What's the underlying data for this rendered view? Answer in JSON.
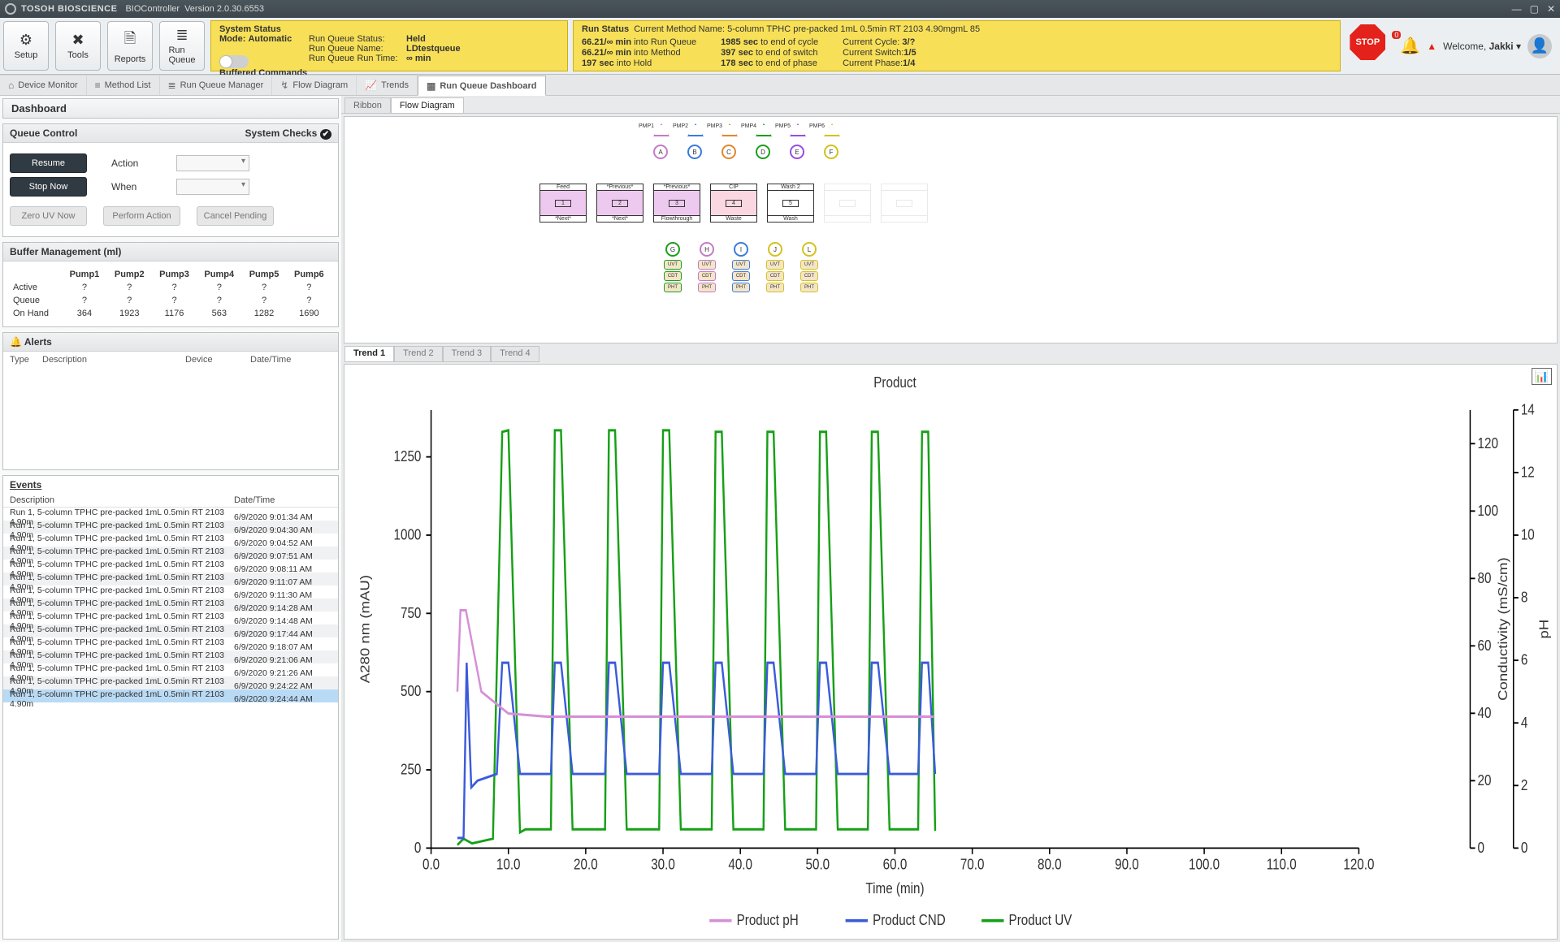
{
  "title_bar": {
    "brand": "TOSOH BIOSCIENCE",
    "app": "BIOController",
    "version": "Version 2.0.30.6553"
  },
  "ribbon_buttons": [
    {
      "label": "Setup",
      "icon": "⚙"
    },
    {
      "label": "Tools",
      "icon": "✖"
    },
    {
      "label": "Reports",
      "icon": "🗎"
    },
    {
      "label": "Run\nQueue",
      "icon": "≣"
    }
  ],
  "system_status": {
    "heading": "System Status",
    "mode_label": "Mode:",
    "mode_value": "Automatic",
    "rqs_label": "Run Queue Status:",
    "rqs_value": "Held",
    "rqn_label": "Run Queue Name:",
    "rqn_value": "LDtestqueue",
    "rqrt_label": "Run Queue Run Time:",
    "rqrt_value": "∞ min",
    "buffered_cmds": "Buffered Commands"
  },
  "run_status": {
    "heading": "Run Status",
    "cm_label": "Current Method Name:",
    "cm_value": "5-column TPHC pre-packed 1mL 0.5min RT 2103 4.90mgmL 85",
    "l1a": "66.21/∞ min",
    "l1b": "into Run Queue",
    "l2a": "66.21/∞ min",
    "l2b": "into Method",
    "l3a": "197 sec",
    "l3b": "into Hold",
    "r1a": "1985 sec",
    "r1b": "to end of cycle",
    "r2a": "397 sec",
    "r2b": "to end of switch",
    "r3a": "178 sec",
    "r3b": "to end of phase",
    "cc_label": "Current Cycle:",
    "cc_val": "3/?",
    "cs_label": "Current Switch:",
    "cs_val": "1/5",
    "cp_label": "Current Phase:",
    "cp_val": "1/4"
  },
  "stop_label": "STOP",
  "notif_count": "0",
  "welcome": "Welcome, ",
  "username": "Jakki",
  "nav_tabs": [
    {
      "label": "Device Monitor",
      "icon": "⌂"
    },
    {
      "label": "Method List",
      "icon": "≡"
    },
    {
      "label": "Run Queue Manager",
      "icon": "≣"
    },
    {
      "label": "Flow Diagram",
      "icon": "↯"
    },
    {
      "label": "Trends",
      "icon": "📈"
    },
    {
      "label": "Run Queue Dashboard",
      "icon": "▦",
      "active": true
    }
  ],
  "dashboard_label": "Dashboard",
  "queue_control": {
    "title": "Queue Control",
    "system_checks": "System Checks",
    "resume": "Resume",
    "stop_now": "Stop Now",
    "action": "Action",
    "when": "When",
    "zero_uv": "Zero UV Now",
    "perform": "Perform Action",
    "cancel": "Cancel Pending"
  },
  "buffer": {
    "title": "Buffer Management (ml)",
    "pumps": [
      "Pump1",
      "Pump2",
      "Pump3",
      "Pump4",
      "Pump5",
      "Pump6"
    ],
    "rows": [
      {
        "label": "Active",
        "vals": [
          "?",
          "?",
          "?",
          "?",
          "?",
          "?"
        ]
      },
      {
        "label": "Queue",
        "vals": [
          "?",
          "?",
          "?",
          "?",
          "?",
          "?"
        ]
      },
      {
        "label": "On Hand",
        "vals": [
          "364",
          "1923",
          "1176",
          "563",
          "1282",
          "1690"
        ]
      }
    ]
  },
  "alerts": {
    "title": "Alerts",
    "cols": [
      "Type",
      "Description",
      "Device",
      "Date/Time"
    ]
  },
  "events": {
    "title": "Events",
    "cols": [
      "Description",
      "Date/Time"
    ],
    "desc_base": "Run 1, 5-column TPHC pre-packed 1mL 0.5min RT 2103 4.90m",
    "times": [
      "6/9/2020 9:01:34 AM",
      "6/9/2020 9:04:30 AM",
      "6/9/2020 9:04:52 AM",
      "6/9/2020 9:07:51 AM",
      "6/9/2020 9:08:11 AM",
      "6/9/2020 9:11:07 AM",
      "6/9/2020 9:11:30 AM",
      "6/9/2020 9:14:28 AM",
      "6/9/2020 9:14:48 AM",
      "6/9/2020 9:17:44 AM",
      "6/9/2020 9:18:07 AM",
      "6/9/2020 9:21:06 AM",
      "6/9/2020 9:21:26 AM",
      "6/9/2020 9:24:22 AM",
      "6/9/2020 9:24:44 AM"
    ]
  },
  "right_tabs": [
    "Ribbon",
    "Flow Diagram"
  ],
  "right_active": 1,
  "trend_tabs": [
    "Trend 1",
    "Trend 2",
    "Trend 3",
    "Trend 4"
  ],
  "trend_active": 0,
  "flow_diagram": {
    "pumps": [
      "PMP1",
      "PMP2",
      "PMP3",
      "PMP4",
      "PMP5",
      "PMP6"
    ],
    "inlets": [
      "A",
      "B",
      "C",
      "D",
      "E",
      "F"
    ],
    "columns": [
      {
        "top": "Feed",
        "num": "1",
        "bot": "*Next*",
        "color": "#c47bc8"
      },
      {
        "top": "*Previous*",
        "num": "2",
        "bot": "*Next*",
        "color": "#c47bc8"
      },
      {
        "top": "*Previous*",
        "num": "3",
        "bot": "Flowthrough",
        "color": "#c47bc8"
      },
      {
        "top": "CIP",
        "num": "4",
        "bot": "Waste",
        "color": "#f1a1b5"
      },
      {
        "top": "Wash 2",
        "num": "5",
        "bot": "Wash",
        "color": "#b7b9ba"
      }
    ],
    "outlets": [
      "G",
      "H",
      "I",
      "J",
      "L"
    ],
    "sensor_stack": [
      "UVT",
      "CDT",
      "PHT"
    ]
  },
  "chart_data": {
    "type": "line",
    "title": "Product",
    "xlabel": "Time (min)",
    "ylabel_left": "A280 nm (mAU)",
    "ylabel_right1": "Conductivity (mS/cm)",
    "ylabel_right2": "pH",
    "xlim": [
      0,
      120
    ],
    "xticks": [
      0,
      10,
      20,
      30,
      40,
      50,
      60,
      70,
      80,
      90,
      100,
      110,
      120
    ],
    "ylim_left": [
      0,
      1400
    ],
    "yticks_left": [
      0,
      250,
      500,
      750,
      1000,
      1250
    ],
    "ylim_right1": [
      0,
      130
    ],
    "yticks_right1": [
      0,
      20,
      40,
      60,
      80,
      100,
      120
    ],
    "ylim_right2": [
      0,
      14
    ],
    "yticks_right2": [
      0,
      2,
      4,
      6,
      8,
      10,
      12,
      14
    ],
    "legend": [
      "Product pH",
      "Product CND",
      "Product UV"
    ],
    "legend_colors": [
      "#d68fd6",
      "#3b5bdb",
      "#16a016"
    ],
    "series": [
      {
        "name": "Product UV",
        "color": "#16a016",
        "axis": "left",
        "x": [
          3.4,
          4.2,
          5.3,
          6.2,
          8.0,
          9.2,
          10.0,
          11.5,
          12.2,
          15.5,
          16.0,
          16.8,
          18.3,
          19.0,
          22.5,
          23.0,
          23.8,
          25.3,
          26.0,
          29.5,
          30.0,
          30.8,
          32.3,
          33.0,
          36.3,
          36.8,
          37.6,
          39.1,
          39.8,
          43.0,
          43.5,
          44.3,
          45.8,
          46.5,
          49.8,
          50.3,
          51.1,
          52.6,
          53.3,
          56.5,
          57.0,
          57.8,
          59.3,
          60.0,
          63.0,
          63.5,
          64.3,
          65.2
        ],
        "y": [
          10,
          30,
          15,
          20,
          30,
          1330,
          1335,
          50,
          60,
          60,
          1335,
          1335,
          60,
          60,
          60,
          1335,
          1335,
          60,
          60,
          60,
          1335,
          1335,
          60,
          60,
          60,
          1330,
          1330,
          60,
          60,
          60,
          1330,
          1330,
          60,
          60,
          60,
          1330,
          1330,
          60,
          60,
          60,
          1330,
          1330,
          60,
          60,
          60,
          1330,
          1330,
          55
        ]
      },
      {
        "name": "Product CND",
        "color": "#3b5bdb",
        "axis": "right1",
        "x": [
          3.4,
          4.2,
          4.6,
          5.2,
          6.0,
          8.5,
          9.2,
          10.0,
          11.5,
          15.5,
          16.0,
          16.8,
          18.3,
          22.5,
          23.0,
          23.8,
          25.3,
          29.5,
          30.0,
          30.8,
          32.3,
          36.3,
          36.8,
          37.6,
          39.1,
          43.0,
          43.5,
          44.3,
          45.8,
          49.8,
          50.3,
          51.1,
          52.6,
          56.5,
          57.0,
          57.8,
          59.3,
          63.0,
          63.5,
          64.3,
          65.2
        ],
        "y": [
          3,
          3,
          55,
          18,
          20,
          22,
          55,
          55,
          22,
          22,
          55,
          55,
          22,
          22,
          55,
          55,
          22,
          22,
          55,
          55,
          22,
          22,
          55,
          55,
          22,
          22,
          55,
          55,
          22,
          22,
          55,
          55,
          22,
          22,
          55,
          55,
          22,
          22,
          55,
          55,
          22
        ]
      },
      {
        "name": "Product pH",
        "color": "#d68fd6",
        "axis": "right2",
        "x": [
          3.4,
          3.8,
          4.5,
          6.5,
          8.5,
          10.0,
          15.0,
          65.0
        ],
        "y": [
          5.0,
          7.6,
          7.6,
          5.0,
          4.6,
          4.3,
          4.2,
          4.2
        ]
      }
    ]
  }
}
